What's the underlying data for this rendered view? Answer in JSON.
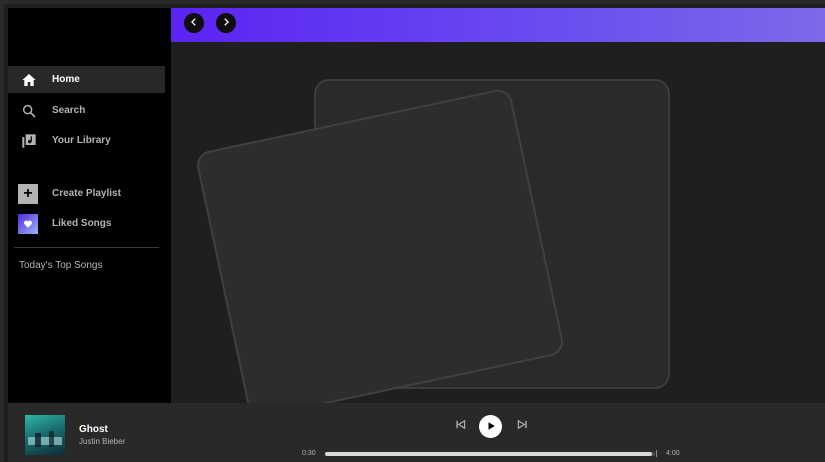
{
  "sidebar": {
    "items": [
      {
        "label": "Home",
        "icon": "home-icon",
        "active": true
      },
      {
        "label": "Search",
        "icon": "search-icon",
        "active": false
      },
      {
        "label": "Your Library",
        "icon": "library-icon",
        "active": false
      }
    ],
    "actions": [
      {
        "label": "Create Playlist",
        "icon": "plus-icon"
      },
      {
        "label": "Liked Songs",
        "icon": "heart-icon"
      }
    ],
    "playlists": [
      "Today's Top Songs"
    ]
  },
  "header": {
    "back_icon": "chevron-left-icon",
    "forward_icon": "chevron-right-icon",
    "gradient_start": "#5a23f2",
    "gradient_end": "#7c6ae8"
  },
  "player": {
    "title": "Ghost",
    "artist": "Justin Bieber",
    "current_time": "0:30",
    "total_time": "4:00",
    "progress_fraction": 0.99
  },
  "colors": {
    "sidebar_bg": "#000000",
    "main_bg": "#1f1f1f",
    "player_bg": "#292929",
    "active_item_bg": "#282828"
  }
}
